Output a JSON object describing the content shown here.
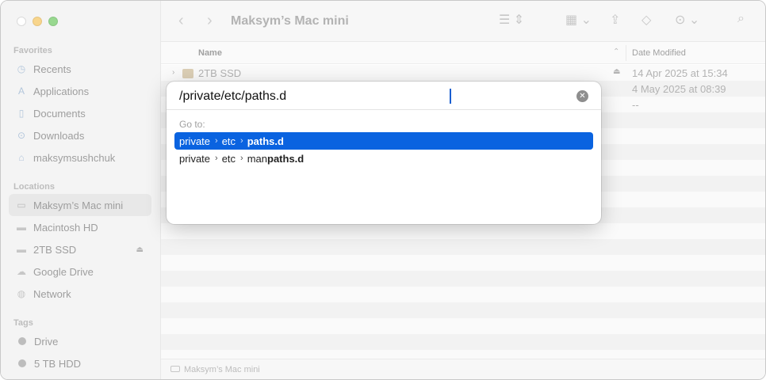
{
  "window": {
    "title": "Maksym’s Mac mini"
  },
  "sidebar": {
    "favorites_heading": "Favorites",
    "favorites": [
      {
        "label": "Recents",
        "icon": "clock-icon"
      },
      {
        "label": "Applications",
        "icon": "applications-icon"
      },
      {
        "label": "Documents",
        "icon": "document-icon"
      },
      {
        "label": "Downloads",
        "icon": "download-icon"
      },
      {
        "label": "maksymsushchuk",
        "icon": "home-icon"
      }
    ],
    "locations_heading": "Locations",
    "locations": [
      {
        "label": "Maksym’s Mac mini",
        "icon": "computer-icon",
        "selected": true
      },
      {
        "label": "Macintosh HD",
        "icon": "disk-icon"
      },
      {
        "label": "2TB SSD",
        "icon": "disk-icon",
        "eject": "⏏"
      },
      {
        "label": "Google Drive",
        "icon": "cloud-icon"
      },
      {
        "label": "Network",
        "icon": "globe-icon"
      }
    ],
    "tags_heading": "Tags",
    "tags": [
      {
        "label": "Drive",
        "color": "#9a9a9a"
      },
      {
        "label": "5 TB HDD",
        "color": "#9a9a9a"
      }
    ]
  },
  "columns": {
    "name": "Name",
    "date_modified": "Date Modified"
  },
  "files": [
    {
      "name": "2TB SSD",
      "eject": "⏏",
      "date": "14 Apr 2025 at 15:34"
    },
    {
      "name": "",
      "eject": "",
      "date": "4 May 2025 at 08:39"
    },
    {
      "name": "",
      "eject": "",
      "date": "--"
    }
  ],
  "statusbar": {
    "path_label": "Maksym’s Mac mini"
  },
  "goto_dialog": {
    "input_value": "/private/etc/paths.d",
    "label": "Go to:",
    "suggestions": [
      {
        "seg1": "private",
        "seg2": "etc",
        "prefix": "",
        "match": "paths.d",
        "selected": true
      },
      {
        "seg1": "private",
        "seg2": "etc",
        "prefix": "man",
        "match": "paths.d",
        "selected": false
      }
    ],
    "accent_color": "#0a63e0"
  }
}
